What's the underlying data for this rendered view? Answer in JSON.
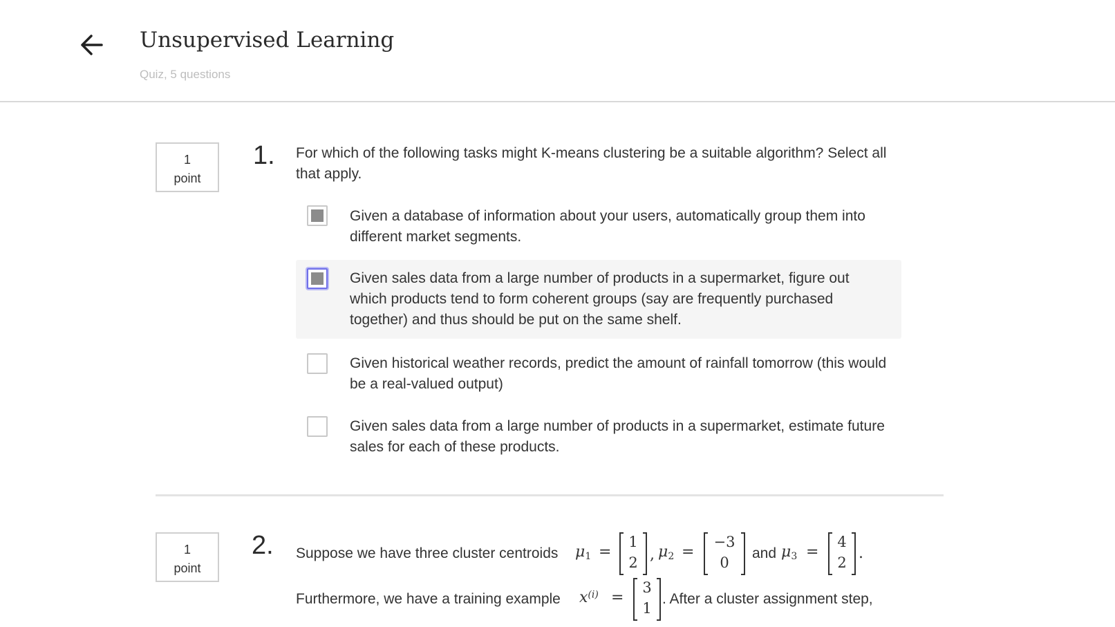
{
  "header": {
    "back_icon": "arrow-left-icon",
    "title": "Unsupervised Learning",
    "subtitle": "Quiz, 5 questions"
  },
  "questions": [
    {
      "points_value": "1",
      "points_unit": "point",
      "number": "1.",
      "text": "For which of the following tasks might K-means clustering be a suitable algorithm? Select all that apply.",
      "options": [
        {
          "text": "Given a database of information about your users, automatically group them into different market segments.",
          "checked": true
        },
        {
          "text": "Given sales data from a large number of products in a supermarket, figure out which products tend to form coherent groups (say are frequently purchased together) and thus should be put on the same shelf.",
          "checked": true
        },
        {
          "text": "Given historical weather records, predict the amount of rainfall tomorrow (this would be a real-valued output)",
          "checked": false
        },
        {
          "text": "Given sales data from a large number of products in a supermarket, estimate future sales for each of these products.",
          "checked": false
        }
      ]
    },
    {
      "points_value": "1",
      "points_unit": "point",
      "number": "2.",
      "line1_prefix": "Suppose we have three cluster centroids",
      "mu": "μ",
      "mu1_sub": "1",
      "mu2_sub": "2",
      "mu3_sub": "3",
      "equals": "=",
      "comma": ",",
      "and": "and",
      "period": ".",
      "mu1_vector": [
        "1",
        "2"
      ],
      "mu2_vector": [
        "−3",
        "0"
      ],
      "mu3_vector": [
        "4",
        "2"
      ],
      "line2_prefix": "Furthermore, we have a training example",
      "x_symbol": "x",
      "x_sup": "(i)",
      "x_vector": [
        "3",
        "1"
      ],
      "line2_suffix": ". After a cluster assignment step,"
    }
  ]
}
